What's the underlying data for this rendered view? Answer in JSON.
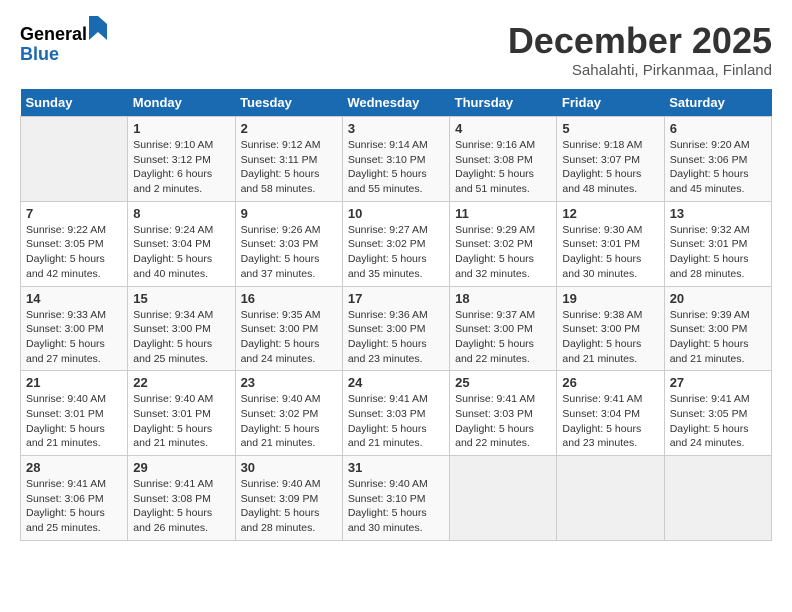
{
  "logo": {
    "general": "General",
    "blue": "Blue"
  },
  "header": {
    "month": "December 2025",
    "location": "Sahalahti, Pirkanmaa, Finland"
  },
  "weekdays": [
    "Sunday",
    "Monday",
    "Tuesday",
    "Wednesday",
    "Thursday",
    "Friday",
    "Saturday"
  ],
  "weeks": [
    [
      {
        "day": "",
        "empty": true
      },
      {
        "day": "1",
        "sunrise": "9:10 AM",
        "sunset": "3:12 PM",
        "daylight": "6 hours and 2 minutes."
      },
      {
        "day": "2",
        "sunrise": "9:12 AM",
        "sunset": "3:11 PM",
        "daylight": "5 hours and 58 minutes."
      },
      {
        "day": "3",
        "sunrise": "9:14 AM",
        "sunset": "3:10 PM",
        "daylight": "5 hours and 55 minutes."
      },
      {
        "day": "4",
        "sunrise": "9:16 AM",
        "sunset": "3:08 PM",
        "daylight": "5 hours and 51 minutes."
      },
      {
        "day": "5",
        "sunrise": "9:18 AM",
        "sunset": "3:07 PM",
        "daylight": "5 hours and 48 minutes."
      },
      {
        "day": "6",
        "sunrise": "9:20 AM",
        "sunset": "3:06 PM",
        "daylight": "5 hours and 45 minutes."
      }
    ],
    [
      {
        "day": "7",
        "sunrise": "9:22 AM",
        "sunset": "3:05 PM",
        "daylight": "5 hours and 42 minutes."
      },
      {
        "day": "8",
        "sunrise": "9:24 AM",
        "sunset": "3:04 PM",
        "daylight": "5 hours and 40 minutes."
      },
      {
        "day": "9",
        "sunrise": "9:26 AM",
        "sunset": "3:03 PM",
        "daylight": "5 hours and 37 minutes."
      },
      {
        "day": "10",
        "sunrise": "9:27 AM",
        "sunset": "3:02 PM",
        "daylight": "5 hours and 35 minutes."
      },
      {
        "day": "11",
        "sunrise": "9:29 AM",
        "sunset": "3:02 PM",
        "daylight": "5 hours and 32 minutes."
      },
      {
        "day": "12",
        "sunrise": "9:30 AM",
        "sunset": "3:01 PM",
        "daylight": "5 hours and 30 minutes."
      },
      {
        "day": "13",
        "sunrise": "9:32 AM",
        "sunset": "3:01 PM",
        "daylight": "5 hours and 28 minutes."
      }
    ],
    [
      {
        "day": "14",
        "sunrise": "9:33 AM",
        "sunset": "3:00 PM",
        "daylight": "5 hours and 27 minutes."
      },
      {
        "day": "15",
        "sunrise": "9:34 AM",
        "sunset": "3:00 PM",
        "daylight": "5 hours and 25 minutes."
      },
      {
        "day": "16",
        "sunrise": "9:35 AM",
        "sunset": "3:00 PM",
        "daylight": "5 hours and 24 minutes."
      },
      {
        "day": "17",
        "sunrise": "9:36 AM",
        "sunset": "3:00 PM",
        "daylight": "5 hours and 23 minutes."
      },
      {
        "day": "18",
        "sunrise": "9:37 AM",
        "sunset": "3:00 PM",
        "daylight": "5 hours and 22 minutes."
      },
      {
        "day": "19",
        "sunrise": "9:38 AM",
        "sunset": "3:00 PM",
        "daylight": "5 hours and 21 minutes."
      },
      {
        "day": "20",
        "sunrise": "9:39 AM",
        "sunset": "3:00 PM",
        "daylight": "5 hours and 21 minutes."
      }
    ],
    [
      {
        "day": "21",
        "sunrise": "9:40 AM",
        "sunset": "3:01 PM",
        "daylight": "5 hours and 21 minutes."
      },
      {
        "day": "22",
        "sunrise": "9:40 AM",
        "sunset": "3:01 PM",
        "daylight": "5 hours and 21 minutes."
      },
      {
        "day": "23",
        "sunrise": "9:40 AM",
        "sunset": "3:02 PM",
        "daylight": "5 hours and 21 minutes."
      },
      {
        "day": "24",
        "sunrise": "9:41 AM",
        "sunset": "3:03 PM",
        "daylight": "5 hours and 21 minutes."
      },
      {
        "day": "25",
        "sunrise": "9:41 AM",
        "sunset": "3:03 PM",
        "daylight": "5 hours and 22 minutes."
      },
      {
        "day": "26",
        "sunrise": "9:41 AM",
        "sunset": "3:04 PM",
        "daylight": "5 hours and 23 minutes."
      },
      {
        "day": "27",
        "sunrise": "9:41 AM",
        "sunset": "3:05 PM",
        "daylight": "5 hours and 24 minutes."
      }
    ],
    [
      {
        "day": "28",
        "sunrise": "9:41 AM",
        "sunset": "3:06 PM",
        "daylight": "5 hours and 25 minutes."
      },
      {
        "day": "29",
        "sunrise": "9:41 AM",
        "sunset": "3:08 PM",
        "daylight": "5 hours and 26 minutes."
      },
      {
        "day": "30",
        "sunrise": "9:40 AM",
        "sunset": "3:09 PM",
        "daylight": "5 hours and 28 minutes."
      },
      {
        "day": "31",
        "sunrise": "9:40 AM",
        "sunset": "3:10 PM",
        "daylight": "5 hours and 30 minutes."
      },
      {
        "day": "",
        "empty": true
      },
      {
        "day": "",
        "empty": true
      },
      {
        "day": "",
        "empty": true
      }
    ]
  ],
  "labels": {
    "sunrise": "Sunrise:",
    "sunset": "Sunset:",
    "daylight": "Daylight:"
  }
}
